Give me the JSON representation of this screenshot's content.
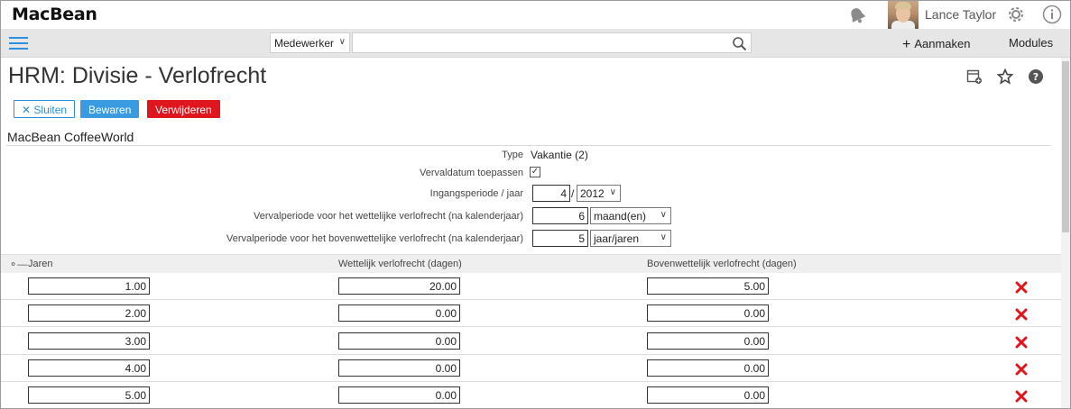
{
  "app": {
    "logo": "MacBean"
  },
  "user": {
    "name": "Lance Taylor"
  },
  "nav": {
    "search_scope": "Medewerker",
    "search_value": "",
    "create_label": "Aanmaken",
    "modules_label": "Modules"
  },
  "page": {
    "title": "HRM: Divisie - Verlofrecht",
    "company": "MacBean CoffeeWorld"
  },
  "actions": {
    "close_label": "Sluiten",
    "save_label": "Bewaren",
    "delete_label": "Verwijderen"
  },
  "form": {
    "type_label": "Type",
    "type_value": "Vakantie (2)",
    "expiry_label": "Vervaldatum toepassen",
    "expiry_checked": "✓",
    "start_label": "Ingangsperiode / jaar",
    "start_period": "4",
    "start_year": "2012",
    "legal_label": "Vervalperiode voor het wettelijke verlofrecht (na kalenderjaar)",
    "legal_value": "6",
    "legal_unit": "maand(en)",
    "extra_label": "Vervalperiode voor het bovenwettelijke verlofrecht (na kalenderjaar)",
    "extra_value": "5",
    "extra_unit": "jaar/jaren"
  },
  "table": {
    "headers": {
      "years": "Jaren",
      "legal": "Wettelijk verlofrecht (dagen)",
      "extra": "Bovenwettelijk verlofrecht (dagen)"
    },
    "rows": [
      {
        "years": "1.00",
        "legal": "20.00",
        "extra": "5.00"
      },
      {
        "years": "2.00",
        "legal": "0.00",
        "extra": "0.00"
      },
      {
        "years": "3.00",
        "legal": "0.00",
        "extra": "0.00"
      },
      {
        "years": "4.00",
        "legal": "0.00",
        "extra": "0.00"
      },
      {
        "years": "5.00",
        "legal": "0.00",
        "extra": "0.00"
      }
    ]
  },
  "colors": {
    "accent": "#2d8fe0",
    "save": "#3a9be0",
    "danger": "#e0161e"
  }
}
